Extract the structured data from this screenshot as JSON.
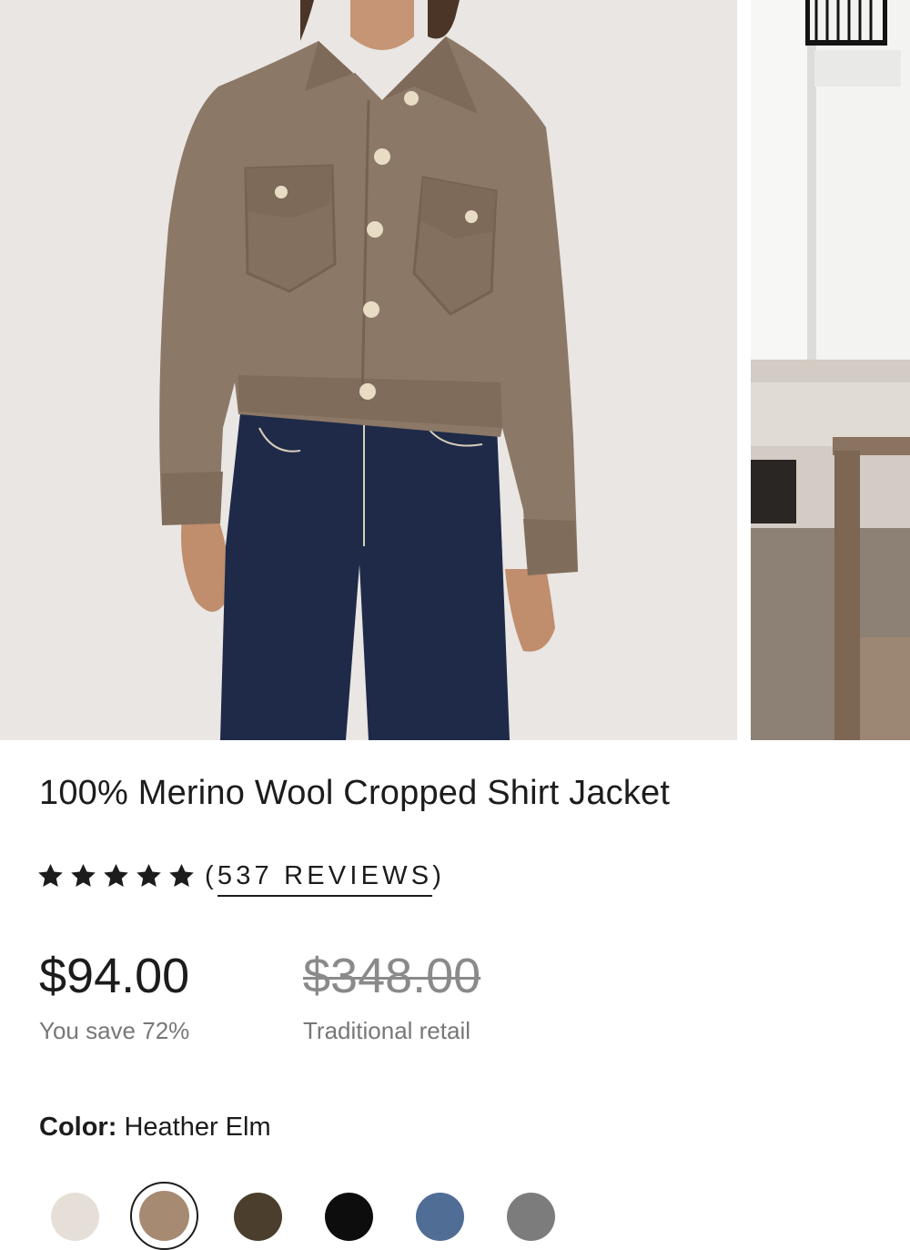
{
  "product": {
    "title": "100% Merino Wool Cropped Shirt Jacket",
    "rating": 5,
    "reviews_text": "(537 REVIEWS)",
    "reviews_open": "(",
    "reviews_count": "537 REVIEWS",
    "reviews_close": ")"
  },
  "pricing": {
    "price": "$94.00",
    "savings": "You save 72%",
    "original_price": "$348.00",
    "original_label": "Traditional retail"
  },
  "color": {
    "label": "Color:",
    "selected": "Heather Elm",
    "swatches": [
      {
        "hex": "#e5dfd8",
        "selected": false
      },
      {
        "hex": "#a68a72",
        "selected": true
      },
      {
        "hex": "#4b3e2c",
        "selected": false
      },
      {
        "hex": "#0d0d0d",
        "selected": false
      },
      {
        "hex": "#4f6d95",
        "selected": false
      },
      {
        "hex": "#7c7c7c",
        "selected": false
      }
    ]
  },
  "gallery": {
    "images": [
      {
        "subject": "model wearing jacket",
        "icon": "product-photo"
      },
      {
        "subject": "interior scene",
        "icon": "product-photo"
      }
    ]
  },
  "colors": {
    "jacket": "#8c7866",
    "denim": "#1e2a48",
    "photo_bg": "#ebe9e6"
  }
}
